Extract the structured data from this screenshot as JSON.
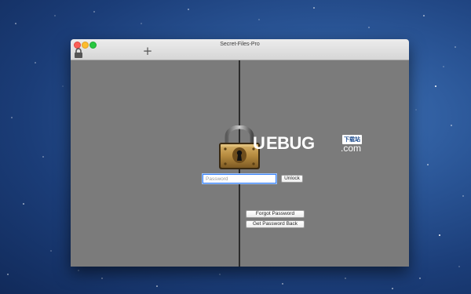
{
  "window": {
    "title": "Secret-Files-Pro"
  },
  "toolbar": {
    "lock_icon": "lock-icon",
    "add_label": "+"
  },
  "login": {
    "password_placeholder": "Password",
    "password_value": "",
    "unlock_label": "Unlock",
    "forgot_label": "Forgot Password",
    "get_back_label": "Get Password Back"
  },
  "watermark": {
    "u": "U",
    "brand": "EBUG",
    "cn": "下载站",
    "dotcom": ".com"
  },
  "colors": {
    "pane": "#7b7b7b",
    "divider": "#2b2b2b",
    "focus_ring": "#3b82f6",
    "padlock_brass": "#b58a3e"
  }
}
